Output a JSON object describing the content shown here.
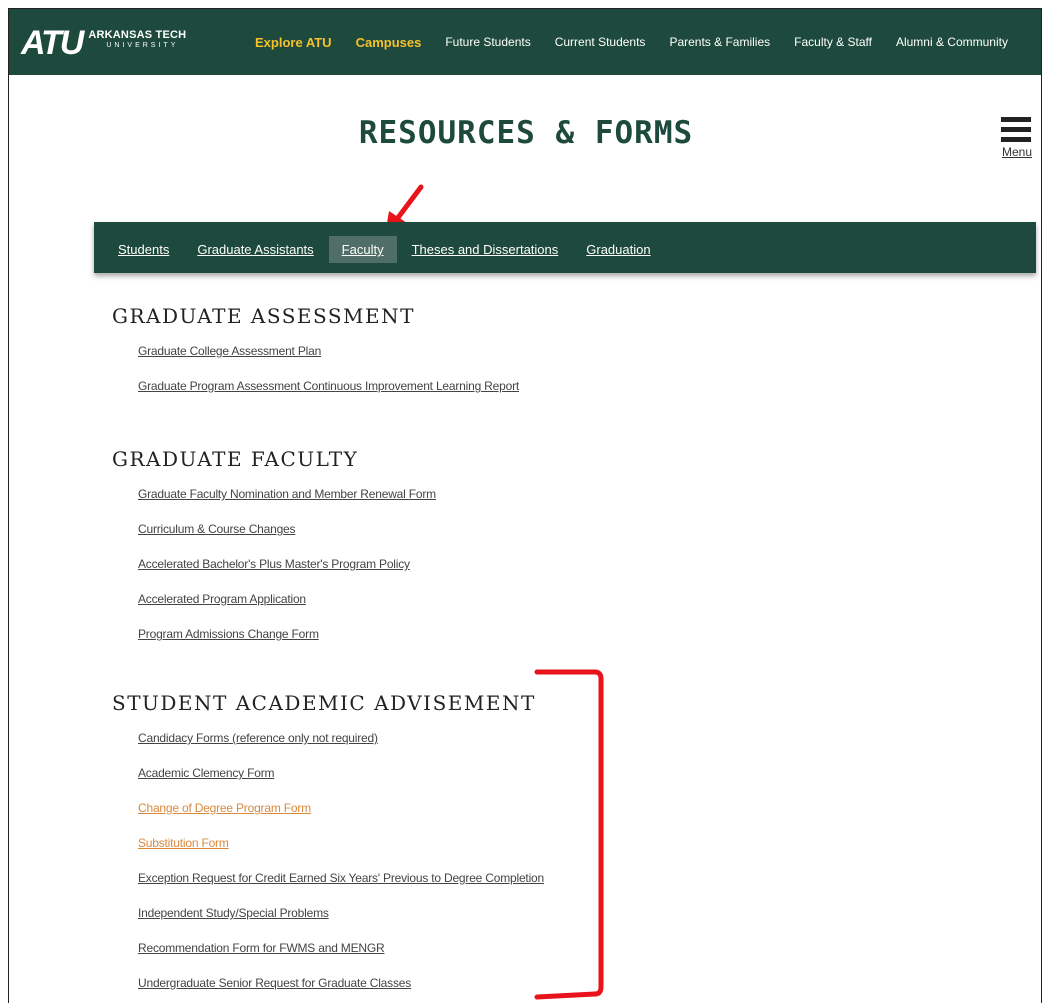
{
  "logo": {
    "mark": "ATU",
    "name": "ARKANSAS TECH",
    "sub": "UNIVERSITY"
  },
  "topnav": [
    {
      "label": "Explore ATU",
      "highlight": true
    },
    {
      "label": "Campuses",
      "highlight": true
    },
    {
      "label": "Future Students",
      "highlight": false
    },
    {
      "label": "Current Students",
      "highlight": false
    },
    {
      "label": "Parents & Families",
      "highlight": false
    },
    {
      "label": "Faculty & Staff",
      "highlight": false
    },
    {
      "label": "Alumni & Community",
      "highlight": false
    }
  ],
  "page_title": "RESOURCES & FORMS",
  "menu_label": "Menu",
  "subnav": [
    {
      "label": "Students",
      "active": false
    },
    {
      "label": "Graduate Assistants",
      "active": false
    },
    {
      "label": "Faculty",
      "active": true
    },
    {
      "label": "Theses and Dissertations",
      "active": false
    },
    {
      "label": "Graduation",
      "active": false
    }
  ],
  "sections": [
    {
      "title": "GRADUATE ASSESSMENT",
      "links": [
        {
          "label": "Graduate College Assessment Plan"
        },
        {
          "label": "Graduate Program Assessment Continuous Improvement Learning Report"
        }
      ]
    },
    {
      "title": "GRADUATE FACULTY",
      "links": [
        {
          "label": "Graduate Faculty Nomination and Member Renewal Form"
        },
        {
          "label": "Curriculum & Course Changes"
        },
        {
          "label": "Accelerated Bachelor's Plus Master's Program Policy"
        },
        {
          "label": "Accelerated Program Application"
        },
        {
          "label": "Program Admissions Change Form"
        }
      ]
    },
    {
      "title": "STUDENT ACADEMIC ADVISEMENT",
      "links": [
        {
          "label": "Candidacy Forms (reference only not required)"
        },
        {
          "label": "Academic Clemency Form"
        },
        {
          "label": "Change of Degree Program Form",
          "visited": true
        },
        {
          "label": "Substitution Form",
          "visited": true
        },
        {
          "label": "Exception Request for Credit Earned Six Years' Previous to Degree Completion"
        },
        {
          "label": "Independent Study/Special Problems"
        },
        {
          "label": "Recommendation Form for FWMS and MENGR"
        },
        {
          "label": "Undergraduate Senior Request for Graduate Classes"
        }
      ]
    }
  ],
  "colors": {
    "brand_green": "#1d4a3c",
    "gold": "#f5c02c",
    "visited_link": "#d9893c",
    "annotation_red": "#e8131b"
  },
  "icons": [
    "hamburger-menu-icon",
    "annotation-arrow-icon",
    "annotation-bracket-icon"
  ]
}
